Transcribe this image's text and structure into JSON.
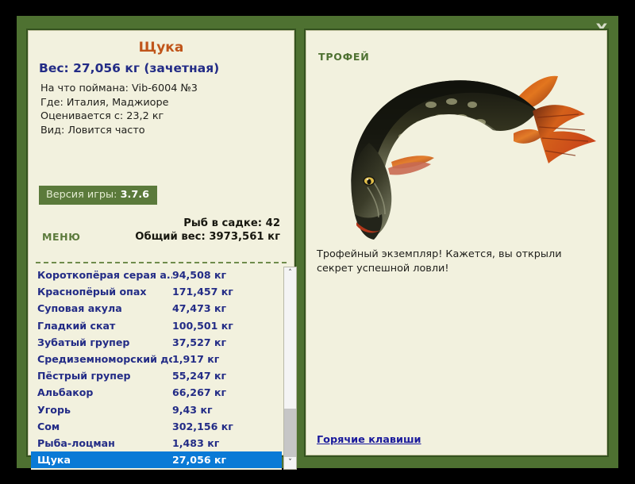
{
  "window": {
    "close_label": "X",
    "frame_color": "#4e7131",
    "panel_color": "#f2f1de"
  },
  "left_panel": {
    "fish_title": "Щука",
    "fish_weight": "Вес: 27,056 кг (зачетная)",
    "details": [
      "На что поймана: Vib-6004 №3",
      "Где: Италия, Маджиоре",
      "Оценивается с: 23,2 кг",
      "Вид: Ловится часто"
    ],
    "version": {
      "label": "Версия игры:",
      "value": "3.7.6"
    },
    "menu_label": "МЕНЮ",
    "stats": {
      "count_line": "Рыб в садке: 42",
      "total_line": "Общий вес: 3973,561 кг"
    },
    "fish_list": [
      {
        "name": "Короткопёрая серая а...",
        "weight": "94,508 кг",
        "selected": false
      },
      {
        "name": "Краснопёрый опах",
        "weight": "171,457 кг",
        "selected": false
      },
      {
        "name": "Суповая акула",
        "weight": "47,473 кг",
        "selected": false
      },
      {
        "name": "Гладкий скат",
        "weight": "100,501 кг",
        "selected": false
      },
      {
        "name": "Зубатый групер",
        "weight": "37,527 кг",
        "selected": false
      },
      {
        "name": "Средиземноморский до...",
        "weight": "1,917 кг",
        "selected": false
      },
      {
        "name": "Пёстрый групер",
        "weight": "55,247 кг",
        "selected": false
      },
      {
        "name": "Альбакор",
        "weight": "66,267 кг",
        "selected": false
      },
      {
        "name": "Угорь",
        "weight": "9,43 кг",
        "selected": false
      },
      {
        "name": "Сом",
        "weight": "302,156 кг",
        "selected": false
      },
      {
        "name": "Рыба-лоцман",
        "weight": "1,483 кг",
        "selected": false
      },
      {
        "name": "Щука",
        "weight": "27,056 кг",
        "selected": true
      }
    ],
    "scrollbar": {
      "up_arrow": "˄",
      "down_arrow": "˅"
    }
  },
  "right_panel": {
    "trophy_label": "ТРОФЕЙ",
    "trophy_text": "Трофейный экземпляр! Кажется, вы открыли секрет успешной ловли!",
    "hotkeys_link": "Горячие клавиши",
    "fish_image_name": "pike-trophy-photo"
  }
}
